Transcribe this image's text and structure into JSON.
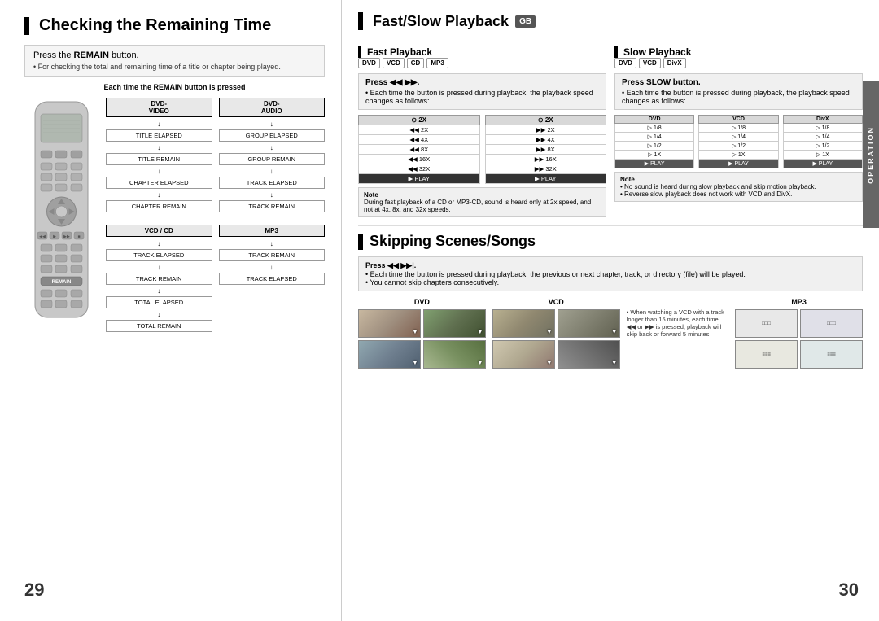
{
  "left_section": {
    "title": "Checking the Remaining Time",
    "instruction_main": "Press the REMAIN button.",
    "instruction_sub": "• For checking the total and remaining time of a title or chapter being played.",
    "diagram_title": "Each time the REMAIN button is pressed",
    "columns": [
      {
        "header": "DVD-VIDEO",
        "items": [
          "TITLE ELAPSED",
          "TITLE REMAIN",
          "CHAPTER ELAPSED",
          "CHAPTER REMAIN"
        ]
      },
      {
        "header": "DVD-AUDIO",
        "items": [
          "GROUP ELAPSED",
          "GROUP REMAIN",
          "TRACK ELAPSED",
          "TRACK REMAIN"
        ]
      },
      {
        "header": "VCD / CD",
        "items": [
          "TRACK ELAPSED",
          "TRACK REMAIN",
          "TOTAL ELAPSED",
          "TOTAL REMAIN"
        ]
      },
      {
        "header": "MP3",
        "items": [
          "TRACK REMAIN",
          "TRACK ELAPSED"
        ]
      }
    ],
    "page_number": "29"
  },
  "right_section": {
    "title": "Fast/Slow Playback",
    "gb_badge": "GB",
    "fast_playback": {
      "title": "Fast Playback",
      "formats": [
        "DVD",
        "VCD",
        "CD",
        "MP3"
      ],
      "press_label": "Press",
      "press_symbol": "◀◀ ▶▶",
      "instruction": "• Each time the button is pressed during playback, the playback speed changes as follows:",
      "dvd_speeds": [
        "2X",
        "4X",
        "8X",
        "16X",
        "32X",
        "▶ PLAY"
      ],
      "vcd_speeds": [
        "2X",
        "4X",
        "8X",
        "16X",
        "32X",
        "▶ PLAY"
      ],
      "note": "During fast playback of a CD or MP3-CD, sound is heard only at 2x speed, and not at 4x, 8x, and 32x speeds."
    },
    "slow_playback": {
      "title": "Slow Playback",
      "formats": [
        "DVD",
        "VCD",
        "DivX"
      ],
      "press_label": "Press SLOW button.",
      "instruction": "• Each time the button is pressed during playback, the playback speed changes as follows:",
      "dvd_speeds": [
        "1/8",
        "1/4",
        "1/2",
        "▶ PLAY"
      ],
      "vcd_speeds": [
        "1/8",
        "1/4",
        "1/2",
        "▶ PLAY"
      ],
      "divx_speeds": [
        "1/8",
        "1/4",
        "1/2",
        "▶ PLAY"
      ],
      "notes": [
        "• No sound is heard during slow playback and skip motion playback.",
        "• Reverse slow playback does not work with VCD and DivX."
      ]
    },
    "skipping": {
      "title": "Skipping Scenes/Songs",
      "press_label": "Press",
      "press_symbol": "◀◀ ▶▶|",
      "instruction_1": "• Each time the button is pressed during playback, the previous or next chapter, track, or directory (file) will be played.",
      "instruction_2": "• You cannot skip chapters consecutively.",
      "formats": [
        "DVD",
        "VCD",
        "MP3"
      ],
      "note": "• When watching a VCD with a track longer than 15 minutes, each time ◀◀ or ▶▶ is pressed, playback will skip back or forward 5 minutes"
    },
    "page_number": "30"
  }
}
